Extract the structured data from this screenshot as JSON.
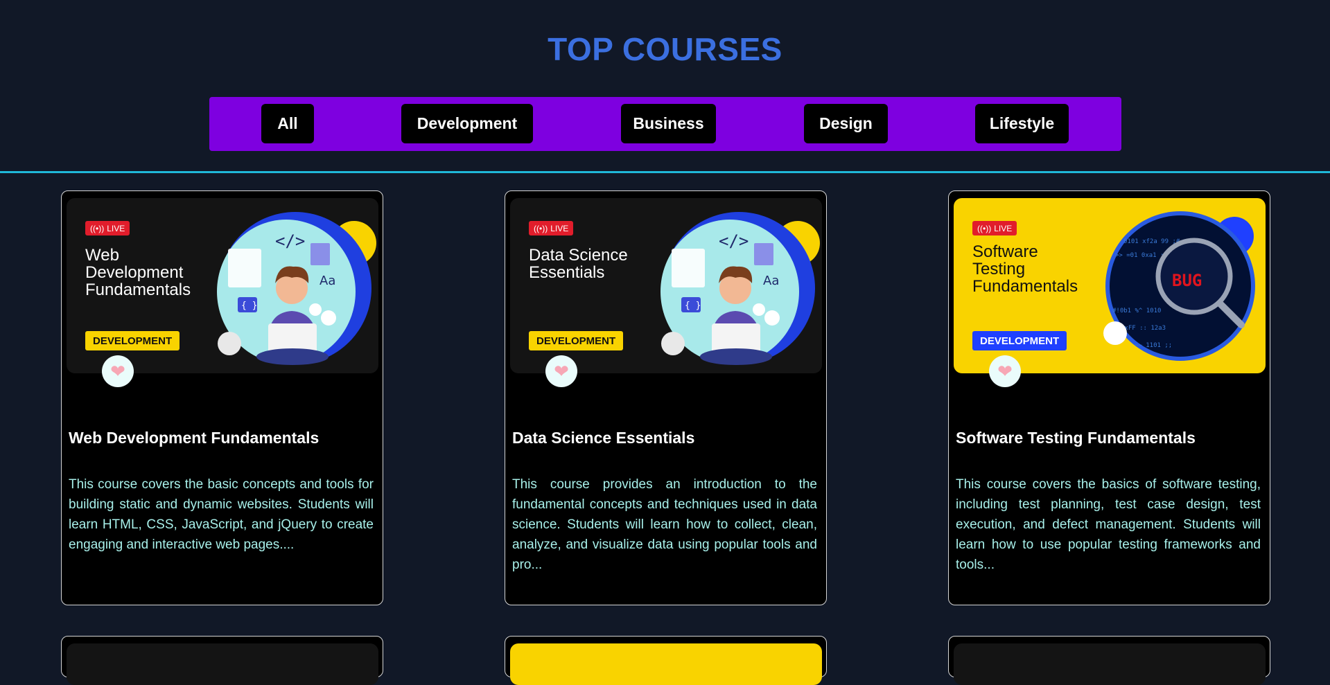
{
  "header": {
    "title": "TOP COURSES"
  },
  "filters": [
    "All",
    "Development",
    "Business",
    "Design",
    "Lifestyle"
  ],
  "live_label": "LIVE",
  "courses": [
    {
      "thumb_title": "Web\nDevelopment\nFundamentals",
      "category": "DEVELOPMENT",
      "title": "Web Development Fundamentals",
      "description": "This course covers the basic concepts and tools for building static and dynamic websites. Students will learn HTML, CSS, JavaScript, and jQuery to create engaging and interactive web pages...."
    },
    {
      "thumb_title": "Data Science\nEssentials",
      "category": "DEVELOPMENT",
      "title": "Data Science Essentials",
      "description": "This course provides an introduction to the fundamental concepts and techniques used in data science. Students will learn how to collect, clean, analyze, and visualize data using popular tools and pro..."
    },
    {
      "thumb_title": "Software\nTesting\nFundamentals",
      "category": "DEVELOPMENT",
      "title": "Software Testing Fundamentals",
      "description": "This course covers the basics of software testing, including test planning, test case design, test execution, and defect management. Students will learn how to use popular testing frameworks and tools...",
      "art_text": "BUG"
    }
  ],
  "colors": {
    "page_bg": "#111827",
    "title": "#3b6fe0",
    "filter_bar": "#7e00e0",
    "divider": "#1fb8d8",
    "badge_yellow": "#f9d300",
    "badge_blue": "#1f40ff",
    "live_red": "#e11d2b",
    "description_text": "#a8f0ea"
  },
  "icons": [
    "live-broadcast-icon",
    "heart-icon",
    "code-icon",
    "magnifier-icon"
  ]
}
